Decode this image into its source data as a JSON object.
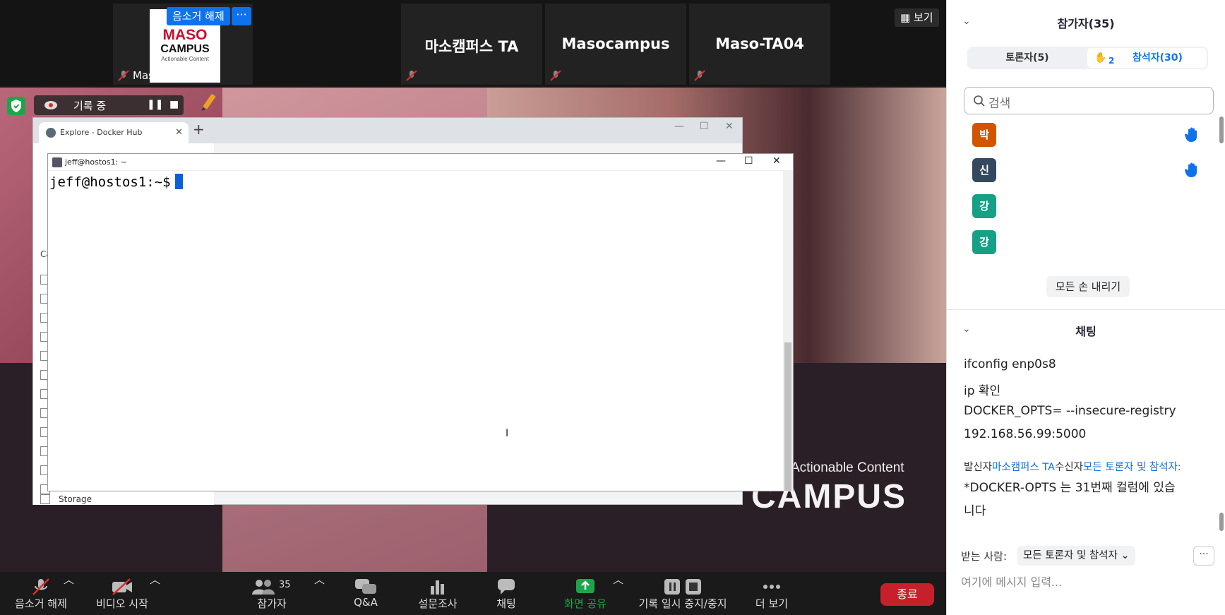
{
  "strip": {
    "tiles": [
      {
        "name": "",
        "label": "Masocampus ..."
      },
      {
        "name": "마소캠퍼스 TA",
        "label": ""
      },
      {
        "name": "Masocampus",
        "label": ""
      },
      {
        "name": "Maso-TA04",
        "label": ""
      }
    ],
    "logo": {
      "line1": "MASO",
      "line2": "CAMPUS",
      "line3": "Actionable Content"
    },
    "unmute_pill": "음소거 해제",
    "more_pill": "···",
    "view_button": "보기"
  },
  "recording": {
    "label": "기록 중"
  },
  "slide": {
    "tagline": "Actionable Content",
    "brand": "CAMPUS"
  },
  "browser": {
    "tab_title": "Explore - Docker Hub",
    "category_label": "Ca",
    "storage_label": "Storage"
  },
  "terminal": {
    "title": "jeff@hostos1: ~",
    "prompt": "jeff@hostos1:~$"
  },
  "toolbar": {
    "items": [
      {
        "label": "음소거 해제",
        "icon": "mic-muted-icon"
      },
      {
        "label": "비디오 시작",
        "icon": "video-off-icon"
      },
      {
        "label": "참가자",
        "icon": "participants-icon",
        "count": "35"
      },
      {
        "label": "Q&A",
        "icon": "qa-icon"
      },
      {
        "label": "설문조사",
        "icon": "poll-icon"
      },
      {
        "label": "채팅",
        "icon": "chat-icon"
      },
      {
        "label": "화면 공유",
        "icon": "share-screen-icon"
      },
      {
        "label": "기록 일시 중지/중지",
        "icon": "record-control-icon"
      },
      {
        "label": "더 보기",
        "icon": "more-icon"
      }
    ],
    "end_label": "종료"
  },
  "panel": {
    "participants_title": "참가자(35)",
    "tab_panelists": "토론자(5)",
    "raised_count": "2",
    "tab_attendees": "참석자(30)",
    "search_placeholder": "검색",
    "participants": [
      {
        "initial": "박",
        "color": "#d35400",
        "hand": true
      },
      {
        "initial": "신",
        "color": "#34495e",
        "hand": true
      },
      {
        "initial": "강",
        "color": "#16a085",
        "hand": false
      },
      {
        "initial": "강",
        "color": "#16a085",
        "hand": false
      }
    ],
    "lower_all": "모든 손 내리기",
    "chat_title": "채팅",
    "messages": [
      "ifconfig enp0s8",
      "ip 확인",
      "DOCKER_OPTS= --insecure-registry",
      "192.168.56.99:5000"
    ],
    "sender_prefix": "발신자",
    "sender_name": "마소캠퍼스 TA",
    "receiver_prefix": "수신자",
    "receiver_name": "모든 토론자 및 참석자:",
    "message2_line1": "*DOCKER-OPTS 는 31번째 컬럼에 있습",
    "message2_line2": "니다",
    "to_label": "받는 사람:",
    "to_value": "모든 토론자 및 참석자",
    "input_placeholder": "여기에 메시지 입력..."
  },
  "colors": {
    "accent": "#0e72ed",
    "end": "#c8202a",
    "share": "#1ea54a"
  }
}
